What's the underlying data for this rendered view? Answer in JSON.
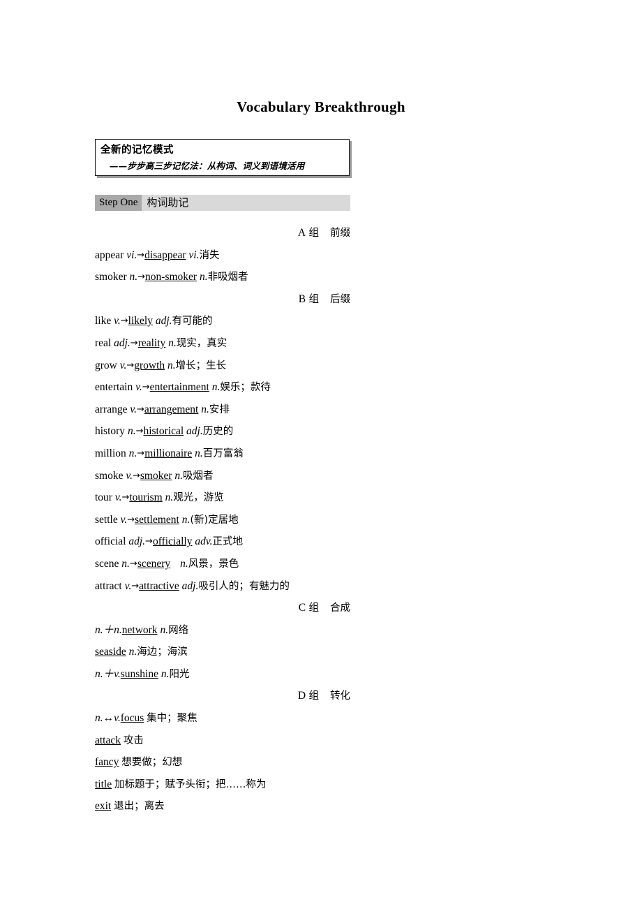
{
  "page": {
    "title": "Vocabulary Breakthrough"
  },
  "callout": {
    "heading": "全新的记忆模式",
    "subheading": "——步步高三步记忆法：从构词、词义到语境活用"
  },
  "step": {
    "badge": "Step One",
    "title": "构词助记"
  },
  "groups": [
    {
      "letter": "A",
      "unit": "组",
      "name": "前缀",
      "entries": [
        {
          "base": "appear",
          "base_pos": "vi.",
          "arrow": "→",
          "derived": "disappear",
          "derived_pos": "vi.",
          "meaning": "消失"
        },
        {
          "base": "smoker",
          "base_pos": "n.",
          "arrow": "→",
          "derived": "non-smoker",
          "derived_pos": "n.",
          "meaning": "非吸烟者"
        }
      ]
    },
    {
      "letter": "B",
      "unit": "组",
      "name": "后缀",
      "entries": [
        {
          "base": "like",
          "base_pos": "v.",
          "arrow": "→",
          "derived": "likely",
          "derived_pos": "adj.",
          "meaning": "有可能的"
        },
        {
          "base": "real",
          "base_pos": "adj.",
          "arrow": "→",
          "derived": "reality",
          "derived_pos": "n.",
          "meaning": "现实，真实"
        },
        {
          "base": "grow",
          "base_pos": "v.",
          "arrow": "→",
          "derived": "growth",
          "derived_pos": "n.",
          "meaning": "增长；生长"
        },
        {
          "base": "entertain",
          "base_pos": "v.",
          "arrow": "→",
          "derived": "entertainment",
          "derived_pos": "n.",
          "meaning": "娱乐；款待"
        },
        {
          "base": "arrange",
          "base_pos": "v.",
          "arrow": "→",
          "derived": "arrangement",
          "derived_pos": "n.",
          "meaning": "安排"
        },
        {
          "base": "history",
          "base_pos": "n.",
          "arrow": "→",
          "derived": "historical",
          "derived_pos": "adj.",
          "meaning": "历史的"
        },
        {
          "base": "million",
          "base_pos": "n.",
          "arrow": "→",
          "derived": "millionaire",
          "derived_pos": "n.",
          "meaning": "百万富翁"
        },
        {
          "base": "smoke",
          "base_pos": "v.",
          "arrow": "→",
          "derived": "smoker",
          "derived_pos": "n.",
          "meaning": "吸烟者"
        },
        {
          "base": "tour",
          "base_pos": "v.",
          "arrow": "→",
          "derived": "tourism",
          "derived_pos": "n.",
          "meaning": "观光，游览"
        },
        {
          "base": "settle",
          "base_pos": "v.",
          "arrow": "→",
          "derived": "settlement",
          "derived_pos": "n.",
          "meaning": "(新)定居地"
        },
        {
          "base": "official",
          "base_pos": "adj.",
          "arrow": "→",
          "derived": "officially",
          "derived_pos": "adv.",
          "meaning": "正式地"
        },
        {
          "base": "scene",
          "base_pos": "n.",
          "arrow": "→",
          "derived": "scenery",
          "derived_pos": "n.",
          "meaning": "风景，景色",
          "extra_gap": true
        },
        {
          "base": "attract",
          "base_pos": "v.",
          "arrow": "→",
          "derived": "attractive",
          "derived_pos": "adj.",
          "meaning": "吸引人的；有魅力的"
        }
      ]
    },
    {
      "letter": "C",
      "unit": "组",
      "name": "合成",
      "entries": [
        {
          "formula": "n.＋n.",
          "derived": "network",
          "derived_pos": "n.",
          "meaning": "网络"
        },
        {
          "formula": "",
          "derived": "seaside",
          "derived_pos": "n.",
          "meaning": "海边；海滨"
        },
        {
          "formula": "n.＋v.",
          "derived": "sunshine",
          "derived_pos": "n.",
          "meaning": "阳光"
        }
      ]
    },
    {
      "letter": "D",
      "unit": "组",
      "name": "转化",
      "entries": [
        {
          "formula": "n.↔v.",
          "derived": "focus",
          "derived_pos": "",
          "meaning": "集中；聚焦"
        },
        {
          "formula": "",
          "derived": "attack",
          "derived_pos": "",
          "meaning": "攻击"
        },
        {
          "formula": "",
          "derived": "fancy",
          "derived_pos": "",
          "meaning": "想要做；幻想"
        },
        {
          "formula": "",
          "derived": "title",
          "derived_pos": "",
          "meaning": "加标题于；赋予头衔；把……称为"
        },
        {
          "formula": "",
          "derived": "exit",
          "derived_pos": "",
          "meaning": "退出；离去"
        }
      ]
    }
  ]
}
